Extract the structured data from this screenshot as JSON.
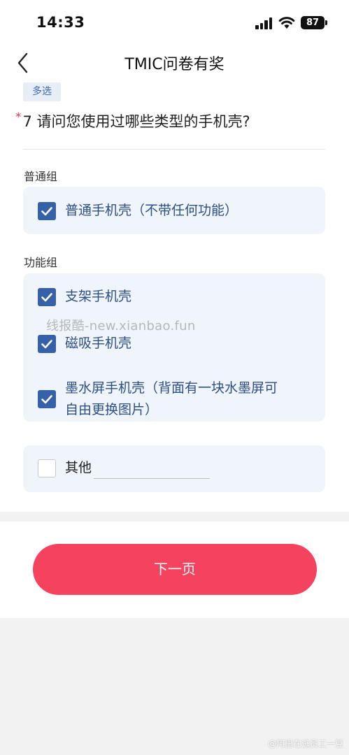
{
  "status_bar": {
    "time": "14:33",
    "battery": "87"
  },
  "nav": {
    "title": "TMIC问卷有奖"
  },
  "question": {
    "tag": "多选",
    "required_mark": "*",
    "title": "7 请问您使用过哪些类型的手机壳?"
  },
  "groups": [
    {
      "label": "普通组",
      "options": [
        {
          "label": "普通手机壳（不带任何功能）",
          "checked": true
        }
      ]
    },
    {
      "label": "功能组",
      "options": [
        {
          "label": "支架手机壳",
          "checked": true
        },
        {
          "label": "磁吸手机壳",
          "checked": true
        },
        {
          "label_line1": "墨水屏手机壳（背面有一块水墨屏可",
          "label_line2": "自由更换图片）",
          "checked": true
        }
      ]
    }
  ],
  "other": {
    "label": "其他",
    "checked": false,
    "value": ""
  },
  "watermark": "线报酷-new.xianbao.fun",
  "next_button": {
    "label": "下一页"
  },
  "credit": "@阿里在逃员工一豆",
  "colors": {
    "accent": "#3561a8",
    "button": "#f5435f",
    "card_bg": "#f0f4fb",
    "required": "#e6374f"
  },
  "icons": {
    "back": "chevron-left-icon",
    "check": "checkmark-icon",
    "signal": "cellular-signal-icon",
    "wifi": "wifi-icon",
    "battery": "battery-icon"
  }
}
